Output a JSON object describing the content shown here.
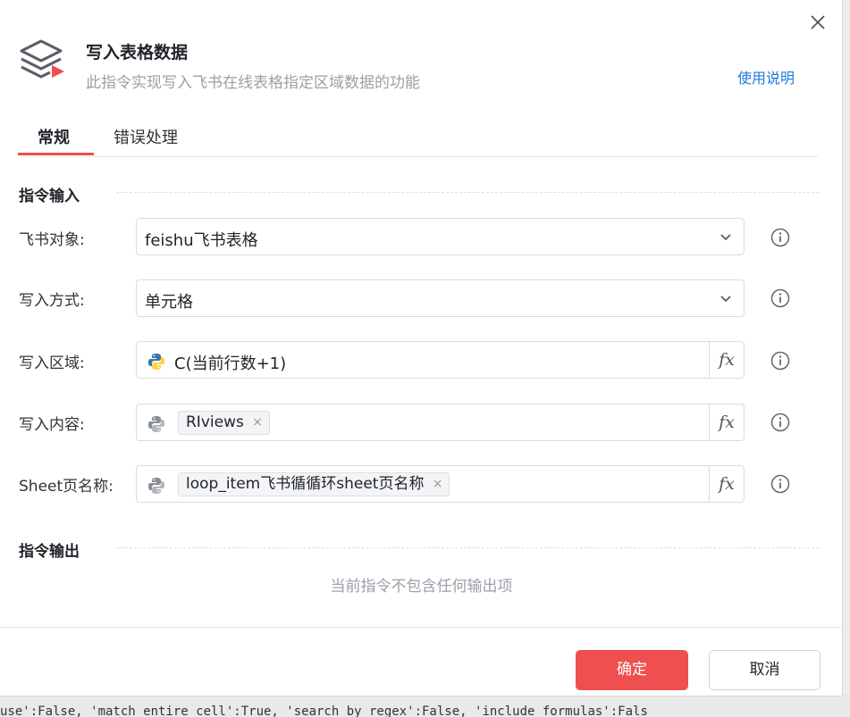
{
  "dialog": {
    "title": "写入表格数据",
    "subtitle": "此指令实现写入飞书在线表格指定区域数据的功能",
    "help_link": "使用说明"
  },
  "tabs": [
    {
      "label": "常规",
      "active": true
    },
    {
      "label": "错误处理",
      "active": false
    }
  ],
  "input_section": {
    "title": "指令输入",
    "fields": [
      {
        "label": "飞书对象:",
        "type": "select",
        "value": "feishu飞书表格",
        "icon": "chevron-down-icon"
      },
      {
        "label": "写入方式:",
        "type": "select",
        "value": "单元格",
        "icon": "chevron-down-icon"
      },
      {
        "label": "写入区域:",
        "type": "expression",
        "value": "C(当前行数+1)",
        "icon": "python-icon"
      },
      {
        "label": "写入内容:",
        "type": "expression",
        "chip": "RIviews",
        "icon": "python-icon"
      },
      {
        "label": "Sheet页名称:",
        "type": "expression",
        "chip": "loop_item飞书循循环sheet页名称",
        "icon": "python-icon"
      }
    ],
    "fx_label": "fx",
    "chip_remove": "×"
  },
  "output_section": {
    "title": "指令输出",
    "empty_text": "当前指令不包含任何输出项"
  },
  "footer": {
    "ok_label": "确定",
    "cancel_label": "取消"
  },
  "background_code_text": "use':False, 'match_entire_cell':True, 'search_by_regex':False, 'include_formulas':Fals",
  "colors": {
    "accent": "#f04f4f",
    "link": "#1f7ae0",
    "python_blue": "#3776ab",
    "python_yellow": "#ffd43b"
  }
}
